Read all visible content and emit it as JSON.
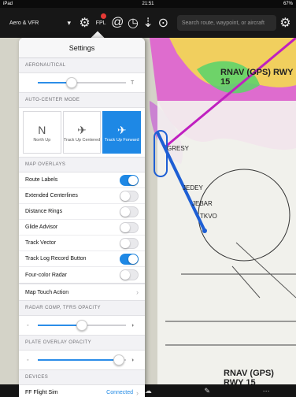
{
  "status": {
    "carrier": "iPad",
    "time": "21:51",
    "battery": "67%"
  },
  "toolbar": {
    "layer": "Aero & VFR",
    "fpl": "FPL",
    "search_placeholder": "Search route, waypoint, or aircraft"
  },
  "map": {
    "procedure_title": "RNAV (GPS) RWY 15",
    "procedure_bottom": "RNAV (GPS) RWY 15",
    "fixes": [
      "GRESY",
      "JEDEY",
      "JEBAR",
      "TKVO"
    ]
  },
  "settings": {
    "title": "Settings",
    "aeronautical_header": "AERONAUTICAL",
    "aeronautical_min_label": "",
    "aeronautical_max_label": "T",
    "aeronautical_level": 0.38,
    "auto_center_header": "AUTO-CENTER MODE",
    "modes": [
      {
        "icon": "north-up-icon",
        "glyph": "N",
        "label": "North Up",
        "selected": false
      },
      {
        "icon": "track-up-centered-icon",
        "glyph": "✈",
        "label": "Track Up Centered",
        "selected": false
      },
      {
        "icon": "track-up-forward-icon",
        "glyph": "✈",
        "label": "Track Up Forward",
        "selected": true
      }
    ],
    "map_overlays_header": "MAP OVERLAYS",
    "overlays": [
      {
        "label": "Route Labels",
        "on": true
      },
      {
        "label": "Extended Centerlines",
        "on": false
      },
      {
        "label": "Distance Rings",
        "on": false
      },
      {
        "label": "Glide Advisor",
        "on": false
      },
      {
        "label": "Track Vector",
        "on": false
      },
      {
        "label": "Track Log Record Button",
        "on": true
      },
      {
        "label": "Four-color Radar",
        "on": false
      }
    ],
    "map_touch_action": "Map Touch Action",
    "radar_header": "RADAR COMP, TFRS OPACITY",
    "radar_level": 0.5,
    "plate_header": "PLATE OVERLAY OPACITY",
    "plate_level": 0.92,
    "devices_header": "DEVICES",
    "device_name": "FF Flight Sim",
    "device_status": "Connected"
  },
  "colors": {
    "accent": "#1e88e5",
    "route": "#c020c0"
  }
}
